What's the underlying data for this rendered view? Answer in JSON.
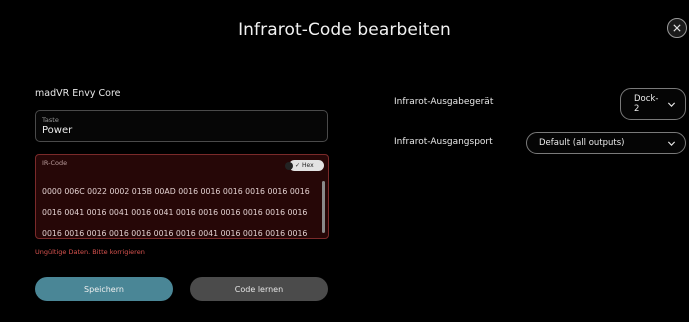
{
  "dialog": {
    "title": "Infrarot-Code bearbeiten"
  },
  "device": {
    "name": "madVR Envy Core"
  },
  "key_field": {
    "label": "Taste",
    "value": "Power"
  },
  "ir_code": {
    "label": "IR-Code",
    "hex_label": "Hex",
    "hex_enabled": true,
    "value": "0000 006C 0022 0002 015B 00AD 0016 0016 0016 0016 0016 0016 0016 0041 0016 0041 0016 0041 0016 0016 0016 0016 0016 0016 0016 0016 0016 0016 0016 0016 0016 0041 0016 0016 0016 0016"
  },
  "error": {
    "message": "Ungültige Daten. Bitte korrigieren"
  },
  "buttons": {
    "save_label": "Speichern",
    "learn_label": "Code lernen"
  },
  "output_device": {
    "label": "Infrarot-Ausgabegerät",
    "selected": "Dock-2"
  },
  "output_port": {
    "label": "Infrarot-Ausgangsport",
    "selected": "Default (all outputs)"
  },
  "colors": {
    "save_button": "#4a8696",
    "learn_button": "#4b4b4b",
    "error_text": "#d9534f",
    "ir_box_bg": "#260707"
  },
  "icons": {
    "close": "close-icon",
    "chevron": "chevron-down-icon",
    "check": "check-icon"
  }
}
